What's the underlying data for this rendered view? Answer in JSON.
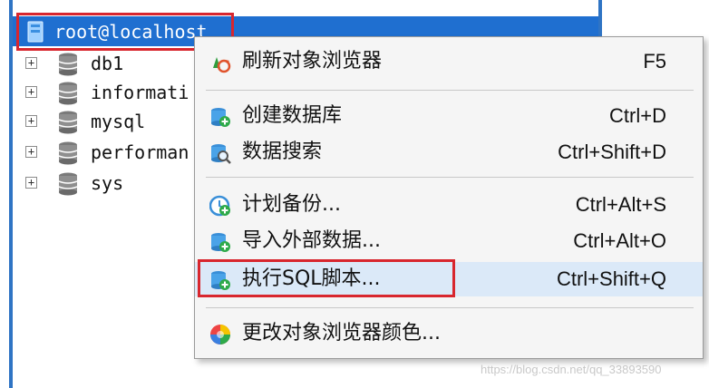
{
  "tree": {
    "server": {
      "label": "root@localhost",
      "icon": "server-icon"
    },
    "databases": [
      {
        "name": "db1",
        "expand": "+",
        "icon": "database-icon"
      },
      {
        "name": "informati",
        "expand": "+",
        "icon": "database-icon"
      },
      {
        "name": "mysql",
        "expand": "+",
        "icon": "database-icon"
      },
      {
        "name": "performan",
        "expand": "+",
        "icon": "database-icon"
      },
      {
        "name": "sys",
        "expand": "+",
        "icon": "database-icon"
      }
    ]
  },
  "context_menu": {
    "items": [
      {
        "label": "刷新对象浏览器",
        "shortcut": "F5",
        "icon": "refresh-icon"
      },
      {
        "label": "创建数据库",
        "shortcut": "Ctrl+D",
        "icon": "create-database-icon"
      },
      {
        "label": "数据搜索",
        "shortcut": "Ctrl+Shift+D",
        "icon": "data-search-icon"
      },
      {
        "label": "计划备份...",
        "shortcut": "Ctrl+Alt+S",
        "icon": "schedule-backup-icon"
      },
      {
        "label": "导入外部数据...",
        "shortcut": "Ctrl+Alt+O",
        "icon": "import-data-icon"
      },
      {
        "label": "执行SQL脚本...",
        "shortcut": "Ctrl+Shift+Q",
        "icon": "execute-sql-icon"
      },
      {
        "label": "更改对象浏览器颜色...",
        "shortcut": "",
        "icon": "color-wheel-icon"
      }
    ],
    "highlighted_item": "执行SQL脚本..."
  },
  "colors": {
    "selection": "#1f6fd0",
    "highlight_border": "#d8262e",
    "menu_background": "#f5f5f5",
    "hover": "#dbe9f8"
  },
  "watermark": "https://blog.csdn.net/qq_33893590"
}
